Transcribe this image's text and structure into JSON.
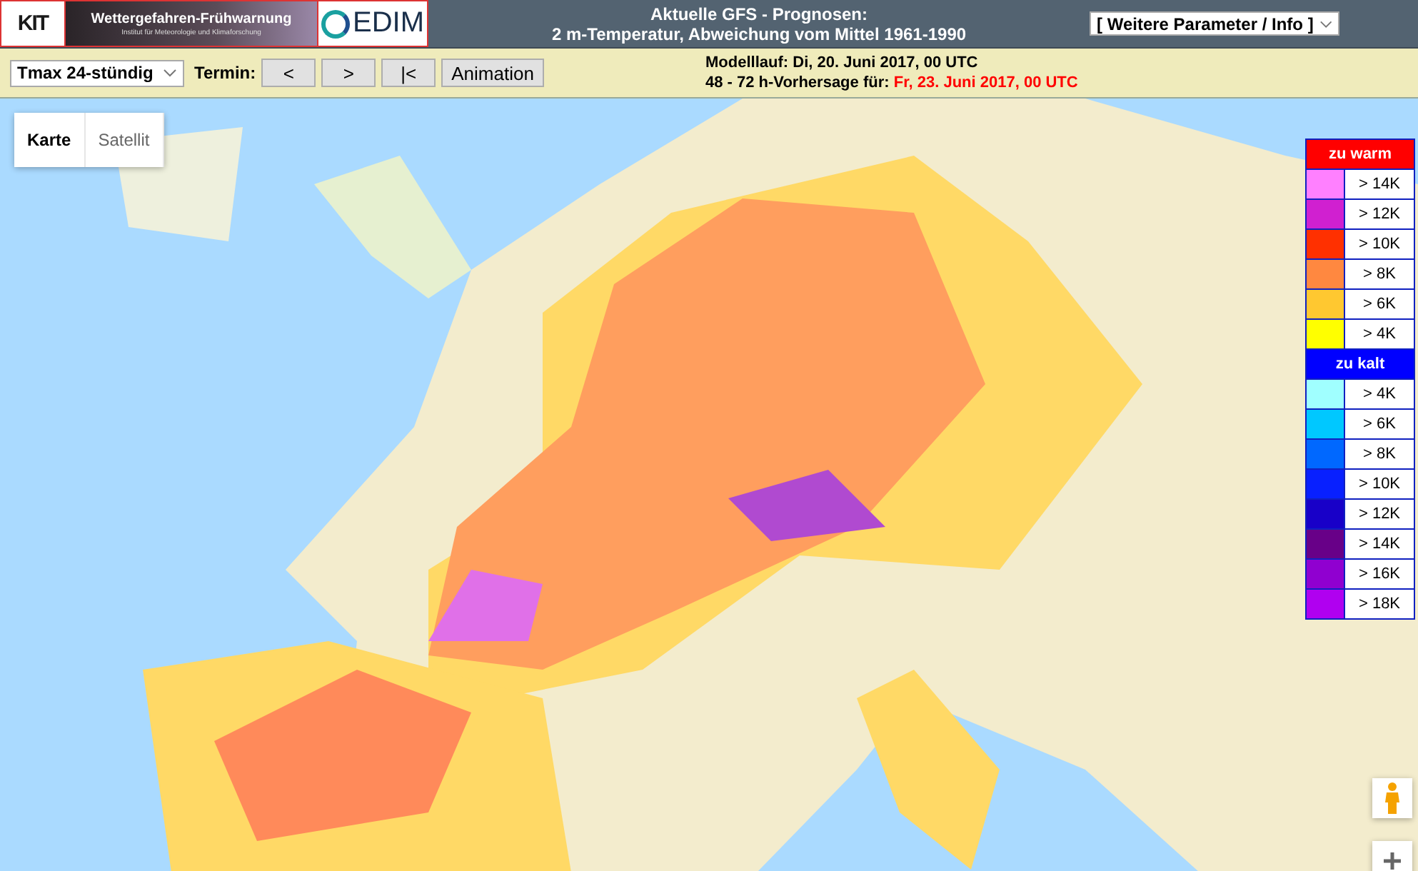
{
  "header": {
    "kit_logo": "KIT",
    "banner": {
      "title": "Wettergefahren-Frühwarnung",
      "subtitle": "Institut für Meteorologie und Klimaforschung"
    },
    "cedim_logo": "EDIM",
    "title_lines": [
      "Aktuelle GFS - Prognosen:",
      "2 m-Temperatur, Abweichung vom Mittel 1961-1990"
    ],
    "param_select": "[ Weitere Parameter / Info ]"
  },
  "toolbar": {
    "period_select": "Tmax 24-stündig",
    "termin_label": "Termin:",
    "buttons": [
      "<",
      ">",
      "|<",
      "Animation"
    ],
    "model_run": {
      "label": "Modelllauf:",
      "value": "Di, 20. Juni 2017, 00 UTC"
    },
    "forecast": {
      "label": "48 - 72 h-Vorhersage für:",
      "value": "Fr, 23. Juni 2017, 00 UTC"
    }
  },
  "map": {
    "type_buttons": [
      {
        "label": "Karte",
        "selected": true
      },
      {
        "label": "Satellit",
        "selected": false
      }
    ],
    "legend": [
      {
        "title": "zu warm",
        "color": "#ff0000",
        "items": [
          {
            "label": "> 14K",
            "color": "#ff80ff"
          },
          {
            "label": "> 12K",
            "color": "#d020d0"
          },
          {
            "label": "> 10K",
            "color": "#ff3000"
          },
          {
            "label": "> 8K",
            "color": "#ff8840"
          },
          {
            "label": "> 6K",
            "color": "#ffc830"
          },
          {
            "label": "> 4K",
            "color": "#ffff00"
          }
        ]
      },
      {
        "title": "zu kalt",
        "color": "#0000ff",
        "items": [
          {
            "label": "> 4K",
            "color": "#a0ffff"
          },
          {
            "label": "> 6K",
            "color": "#00c8ff"
          },
          {
            "label": "> 8K",
            "color": "#0068ff"
          },
          {
            "label": "> 10K",
            "color": "#0820ff"
          },
          {
            "label": "> 12K",
            "color": "#1800c8"
          },
          {
            "label": "> 14K",
            "color": "#680088"
          },
          {
            "label": "> 16K",
            "color": "#9000d0"
          },
          {
            "label": "> 18K",
            "color": "#b000f0"
          }
        ]
      }
    ]
  }
}
